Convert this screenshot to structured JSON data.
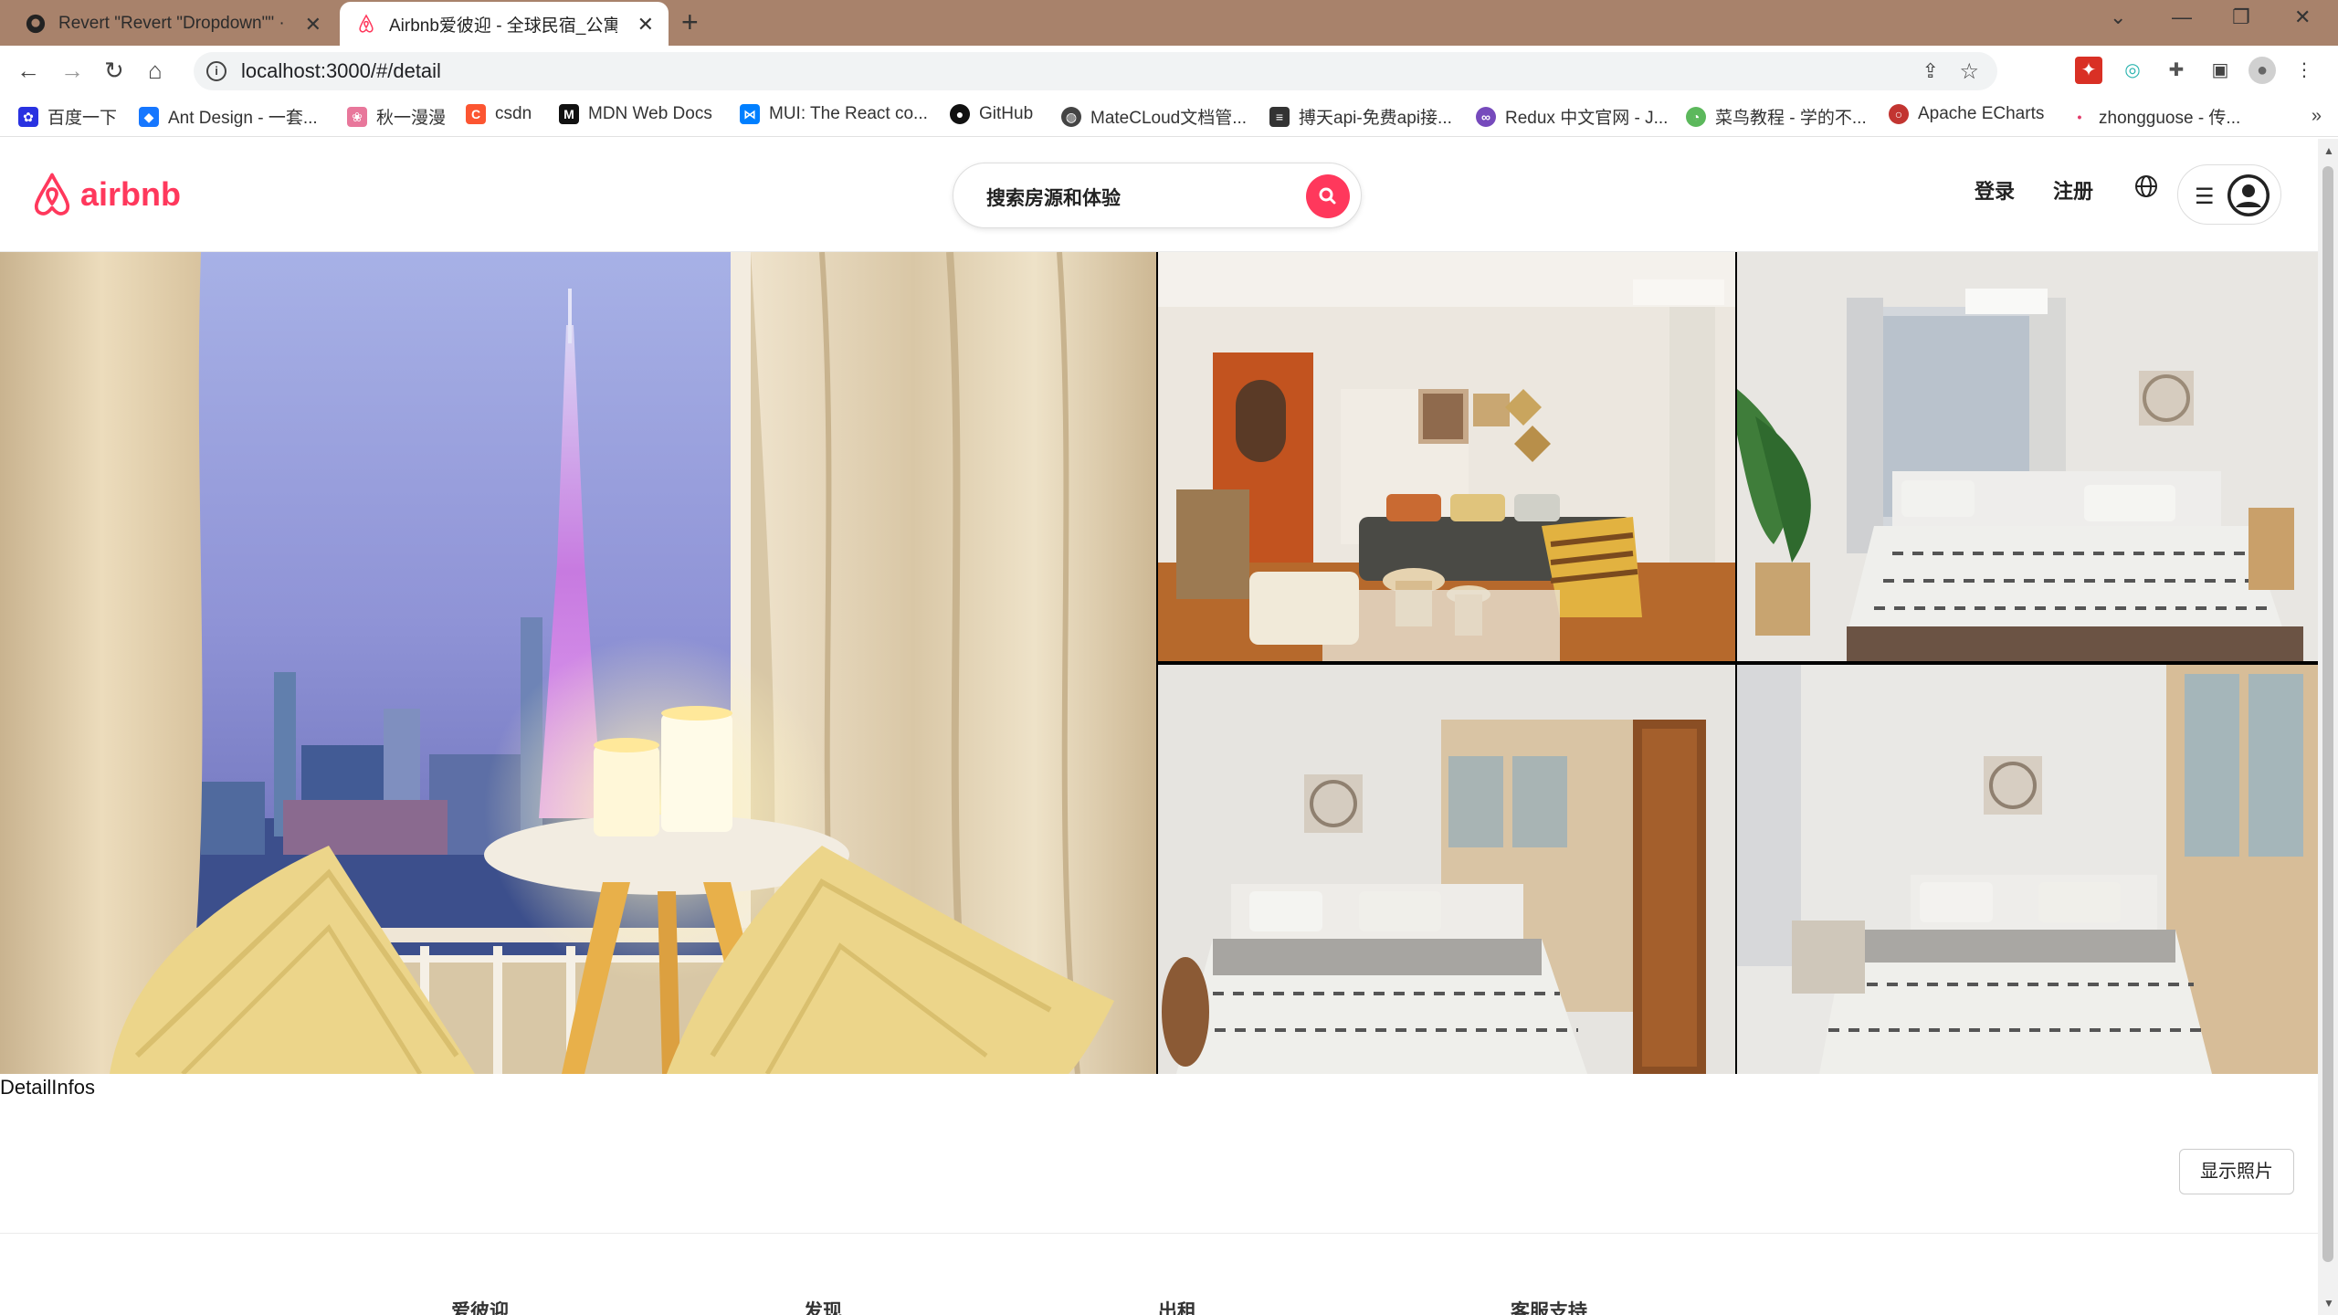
{
  "browser": {
    "tabs": [
      {
        "title": "Revert \"Revert \"Dropdown\"\" ·",
        "active": false
      },
      {
        "title": "Airbnb爱彼迎 - 全球民宿_公寓_",
        "active": true
      }
    ],
    "url": "localhost:3000/#/detail",
    "bookmarks": [
      {
        "label": "百度一下",
        "icon": "baidu-paw",
        "color": "#2932e1"
      },
      {
        "label": "Ant Design - 一套...",
        "icon": "ant-design-diamond",
        "color": "#1677ff"
      },
      {
        "label": "秋一漫漫",
        "icon": "flower",
        "color": "#e8779b"
      },
      {
        "label": "csdn",
        "icon": "csdn-c",
        "color": "#fc5531"
      },
      {
        "label": "MDN Web Docs",
        "icon": "mdn-m",
        "color": "#111111"
      },
      {
        "label": "MUI: The React co...",
        "icon": "mui-logo",
        "color": "#007fff"
      },
      {
        "label": "GitHub",
        "icon": "github-octocat",
        "color": "#111111"
      },
      {
        "label": "MateCLoud文档管...",
        "icon": "matecloud-globe",
        "color": "#444444"
      },
      {
        "label": "搏天api-免费api接...",
        "icon": "api-box",
        "color": "#333333"
      },
      {
        "label": "Redux 中文官网 - J...",
        "icon": "redux-swirl",
        "color": "#764abc"
      },
      {
        "label": "菜鸟教程 - 学的不...",
        "icon": "runoob-bird",
        "color": "#5cb85c"
      },
      {
        "label": "Apache ECharts",
        "icon": "echarts-ring",
        "color": "#c23531"
      },
      {
        "label": "zhongguose - 传...",
        "icon": "red-dot",
        "color": "#e23c6b"
      }
    ]
  },
  "header": {
    "logo_text": "airbnb",
    "search_placeholder": "搜索房源和体验",
    "login": "登录",
    "register": "注册"
  },
  "gallery": {
    "show_photos": "显示照片"
  },
  "detail_infos": "DetailInfos",
  "footer": {
    "columns": [
      "爱彼迎",
      "发现",
      "出租",
      "客服支持"
    ]
  },
  "colors": {
    "brand": "#ff385c",
    "chrome_tabbar": "#a8826b"
  }
}
